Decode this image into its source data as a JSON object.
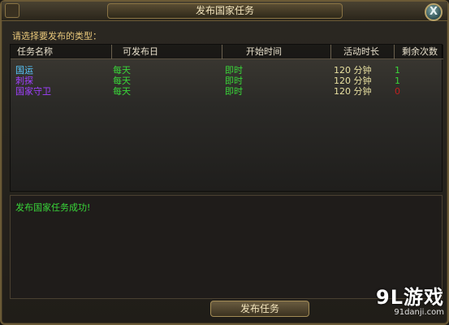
{
  "window": {
    "title": "发布国家任务",
    "close_glyph": "X"
  },
  "prompt": "请选择要发布的类型：",
  "table": {
    "headers": [
      "任务名称",
      "可发布日",
      "开始时间",
      "活动时长",
      "剩余次数"
    ],
    "rows": [
      {
        "name": "国运",
        "day": "每天",
        "start": "即时",
        "duration": "120 分钟",
        "remaining": "1",
        "name_color": "#58c8ff",
        "remaining_color": "#39d639"
      },
      {
        "name": "刺探",
        "day": "每天",
        "start": "即时",
        "duration": "120 分钟",
        "remaining": "1",
        "name_color": "#a040ff",
        "remaining_color": "#39d639"
      },
      {
        "name": "国家守卫",
        "day": "每天",
        "start": "即时",
        "duration": "120 分钟",
        "remaining": "0",
        "name_color": "#a040ff",
        "remaining_color": "#c02020"
      }
    ]
  },
  "message": "发布国家任务成功!",
  "publish_button": "发布任务",
  "watermark": {
    "logo": "9L游戏",
    "url": "91danji.com"
  },
  "colors": {
    "green": "#39d639",
    "gold": "#e8c77a",
    "duration": "#e8e0a0"
  }
}
